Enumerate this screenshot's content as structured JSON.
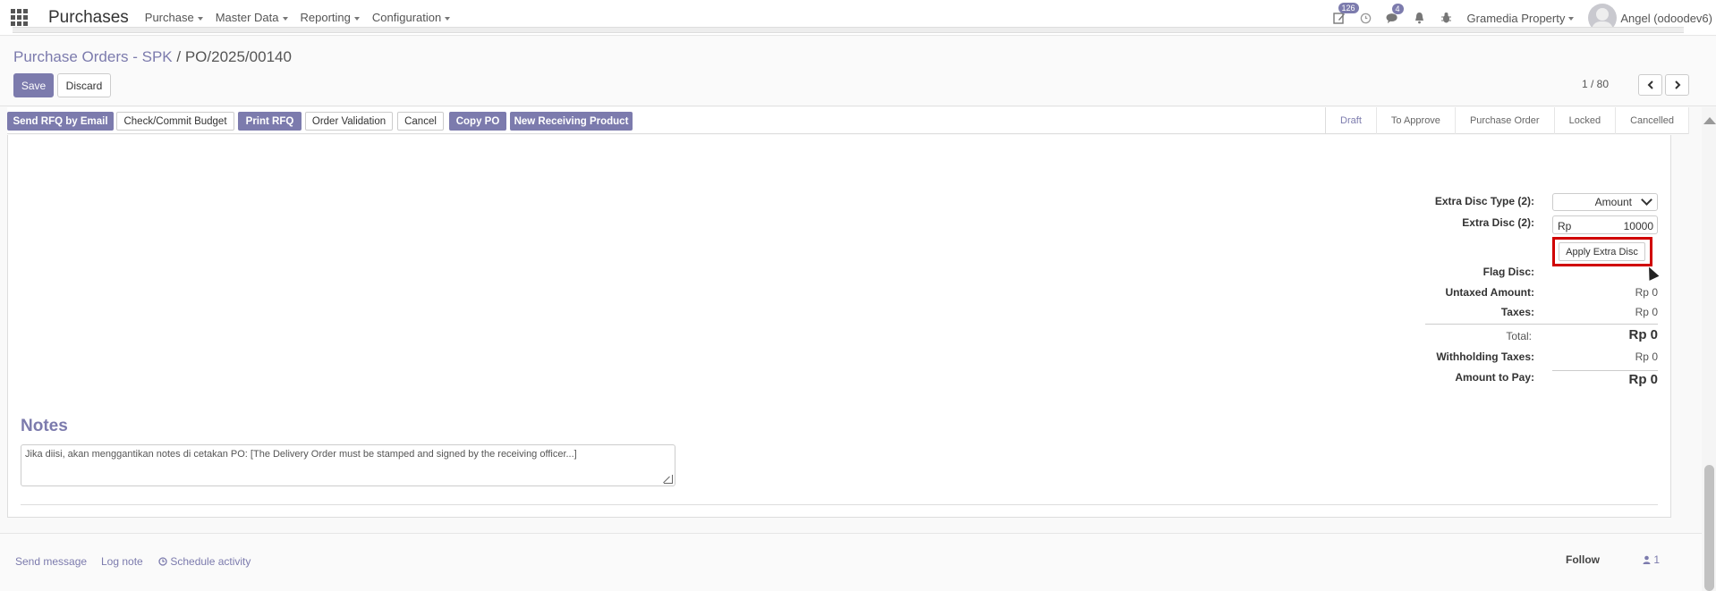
{
  "topbar": {
    "app_title": "Purchases",
    "menu": [
      "Purchase",
      "Master Data",
      "Reporting",
      "Configuration"
    ],
    "badges": {
      "activities": "126",
      "messages": "4"
    },
    "company": "Gramedia Property",
    "user": "Angel (odoodev6)"
  },
  "breadcrumb": {
    "parent": "Purchase Orders - SPK",
    "separator": "/",
    "current": "PO/2025/00140"
  },
  "form_buttons": {
    "save": "Save",
    "discard": "Discard"
  },
  "pager": {
    "value": "1 / 80"
  },
  "actions": [
    "Send RFQ by Email",
    "Check/Commit Budget",
    "Print RFQ",
    "Order Validation",
    "Cancel",
    "Copy PO",
    "New Receiving Product"
  ],
  "stages": [
    "Draft",
    "To Approve",
    "Purchase Order",
    "Locked",
    "Cancelled"
  ],
  "current_stage": "Draft",
  "totals": {
    "extra_disc_type_label": "Extra Disc Type (2):",
    "extra_disc_type_value": "Amount",
    "extra_disc_label": "Extra Disc (2):",
    "extra_disc_currency": "Rp",
    "extra_disc_value": "10000",
    "apply_button": "Apply Extra Disc",
    "flag_disc_label": "Flag Disc:",
    "untaxed_label": "Untaxed Amount:",
    "untaxed_value": "Rp 0",
    "taxes_label": "Taxes:",
    "taxes_value": "Rp 0",
    "total_label": "Total:",
    "total_value": "Rp 0",
    "withholding_label": "Withholding Taxes:",
    "withholding_value": "Rp 0",
    "amount_to_pay_label": "Amount to Pay:",
    "amount_to_pay_value": "Rp 0"
  },
  "notes": {
    "title": "Notes",
    "placeholder": "Jika diisi, akan menggantikan notes di cetakan PO: [The Delivery Order must be stamped and signed by the receiving officer...]"
  },
  "chatter": {
    "send_message": "Send message",
    "log_note": "Log note",
    "schedule_activity": "Schedule activity",
    "follow": "Follow",
    "followers_count": "1"
  },
  "colors": {
    "accent": "#7c7bad",
    "highlight": "#d00000"
  }
}
